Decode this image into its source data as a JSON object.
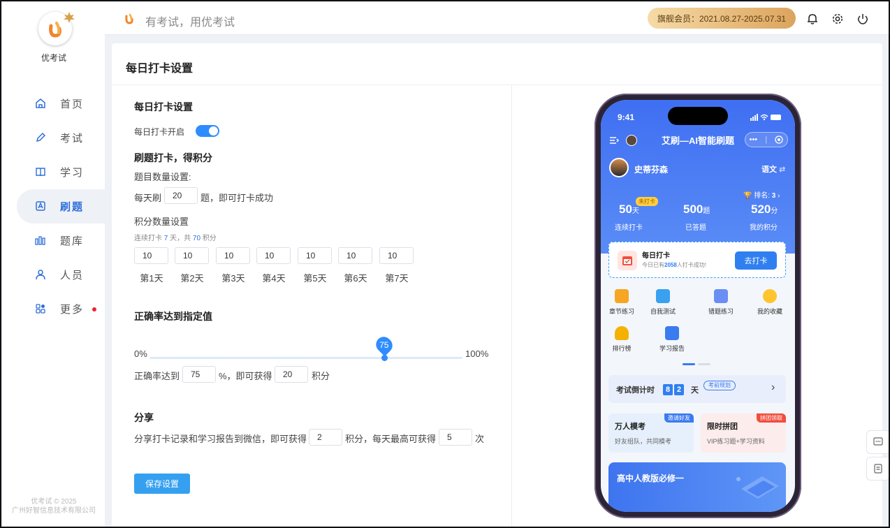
{
  "sidebar": {
    "app_name": "优考试",
    "items": [
      {
        "label": "首页",
        "icon": "home-icon"
      },
      {
        "label": "考试",
        "icon": "pencil-icon"
      },
      {
        "label": "学习",
        "icon": "book-icon"
      },
      {
        "label": "刷题",
        "icon": "practice-icon",
        "active": true
      },
      {
        "label": "题库",
        "icon": "bank-icon"
      },
      {
        "label": "人员",
        "icon": "user-icon"
      },
      {
        "label": "更多",
        "icon": "apps-icon",
        "badge_dot": true
      }
    ],
    "copyright_line1": "优考试 © 2025",
    "copyright_line2": "广州好智信息技术有限公司"
  },
  "header": {
    "slogan": "有考试，用优考试",
    "vip": "旗舰会员：2021.08.27-2025.07.31",
    "icons": [
      "bell-icon",
      "gear-icon",
      "power-icon"
    ]
  },
  "page": {
    "title": "每日打卡设置",
    "section_daily": "每日打卡设置",
    "toggle_label": "每日打卡开启",
    "toggle_on": true,
    "section_points": "刷题打卡，得积分",
    "q_count_label": "题目数量设置:",
    "daily_prefix": "每天刷",
    "daily_value": "20",
    "daily_suffix": "题，即可打卡成功",
    "points_label": "积分数量设置",
    "streak_note_pre": "连续打卡",
    "streak_days": "7",
    "streak_note_mid": "天，共",
    "streak_total": "70",
    "streak_note_post": "积分",
    "day_points": [
      "10",
      "10",
      "10",
      "10",
      "10",
      "10",
      "10"
    ],
    "day_labels": [
      "第1天",
      "第2天",
      "第3天",
      "第4天",
      "第5天",
      "第6天",
      "第7天"
    ],
    "section_accuracy": "正确率达到指定值",
    "slider_min": "0%",
    "slider_max": "100%",
    "slider_value": 75,
    "slider_value_text": "75",
    "acc_prefix": "正确率达到",
    "acc_value": "75",
    "acc_mid": "%，即可获得",
    "acc_points": "20",
    "acc_suffix": "积分",
    "section_share": "分享",
    "share_prefix": "分享打卡记录和学习报告到微信，即可获得",
    "share_points": "2",
    "share_mid": "积分，每天最高可获得",
    "share_max": "5",
    "share_suffix": "次",
    "save_label": "保存设置"
  },
  "phone": {
    "time": "9:41",
    "title": "艾刷—AI智能刷题",
    "capsule_dots": "•••",
    "user": "史蒂芬森",
    "subject": "语文",
    "rank_label": "排名:",
    "rank_value": "3",
    "badge_unchecked": "未打卡",
    "stats": [
      {
        "num": "50",
        "unit": "天",
        "label": "连续打卡"
      },
      {
        "num": "500",
        "unit": "题",
        "label": "已答题"
      },
      {
        "num": "520",
        "unit": "分",
        "label": "我的积分"
      }
    ],
    "checkin_title": "每日打卡",
    "checkin_sub_pre": "今日已有",
    "checkin_count": "2058",
    "checkin_sub_post": "人打卡成功!",
    "checkin_btn": "去打卡",
    "grid": [
      {
        "label": "章节练习",
        "color": "#f5a623"
      },
      {
        "label": "自我测试",
        "color": "#3aa0f0"
      },
      {
        "label": "错题练习",
        "color": "#6b8ef5"
      },
      {
        "label": "我的收藏",
        "color": "#ffc42e"
      },
      {
        "label": "排行榜",
        "color": "#f5b100"
      },
      {
        "label": "学习报告",
        "color": "#3b7bf0"
      }
    ],
    "countdown_label": "考试倒计时",
    "countdown_d1": "8",
    "countdown_d2": "2",
    "countdown_unit": "天",
    "countdown_tag": "考前规划",
    "promo1_title": "万人模考",
    "promo1_sub": "好友组队，共同模考",
    "promo1_tag": "邀请好友",
    "promo2_title": "限时拼团",
    "promo2_sub": "VIP练习题+学习资料",
    "promo2_tag": "拼团领取",
    "banner_title": "高中人教版必修一"
  },
  "float_icons": [
    "chat-icon",
    "note-icon"
  ]
}
